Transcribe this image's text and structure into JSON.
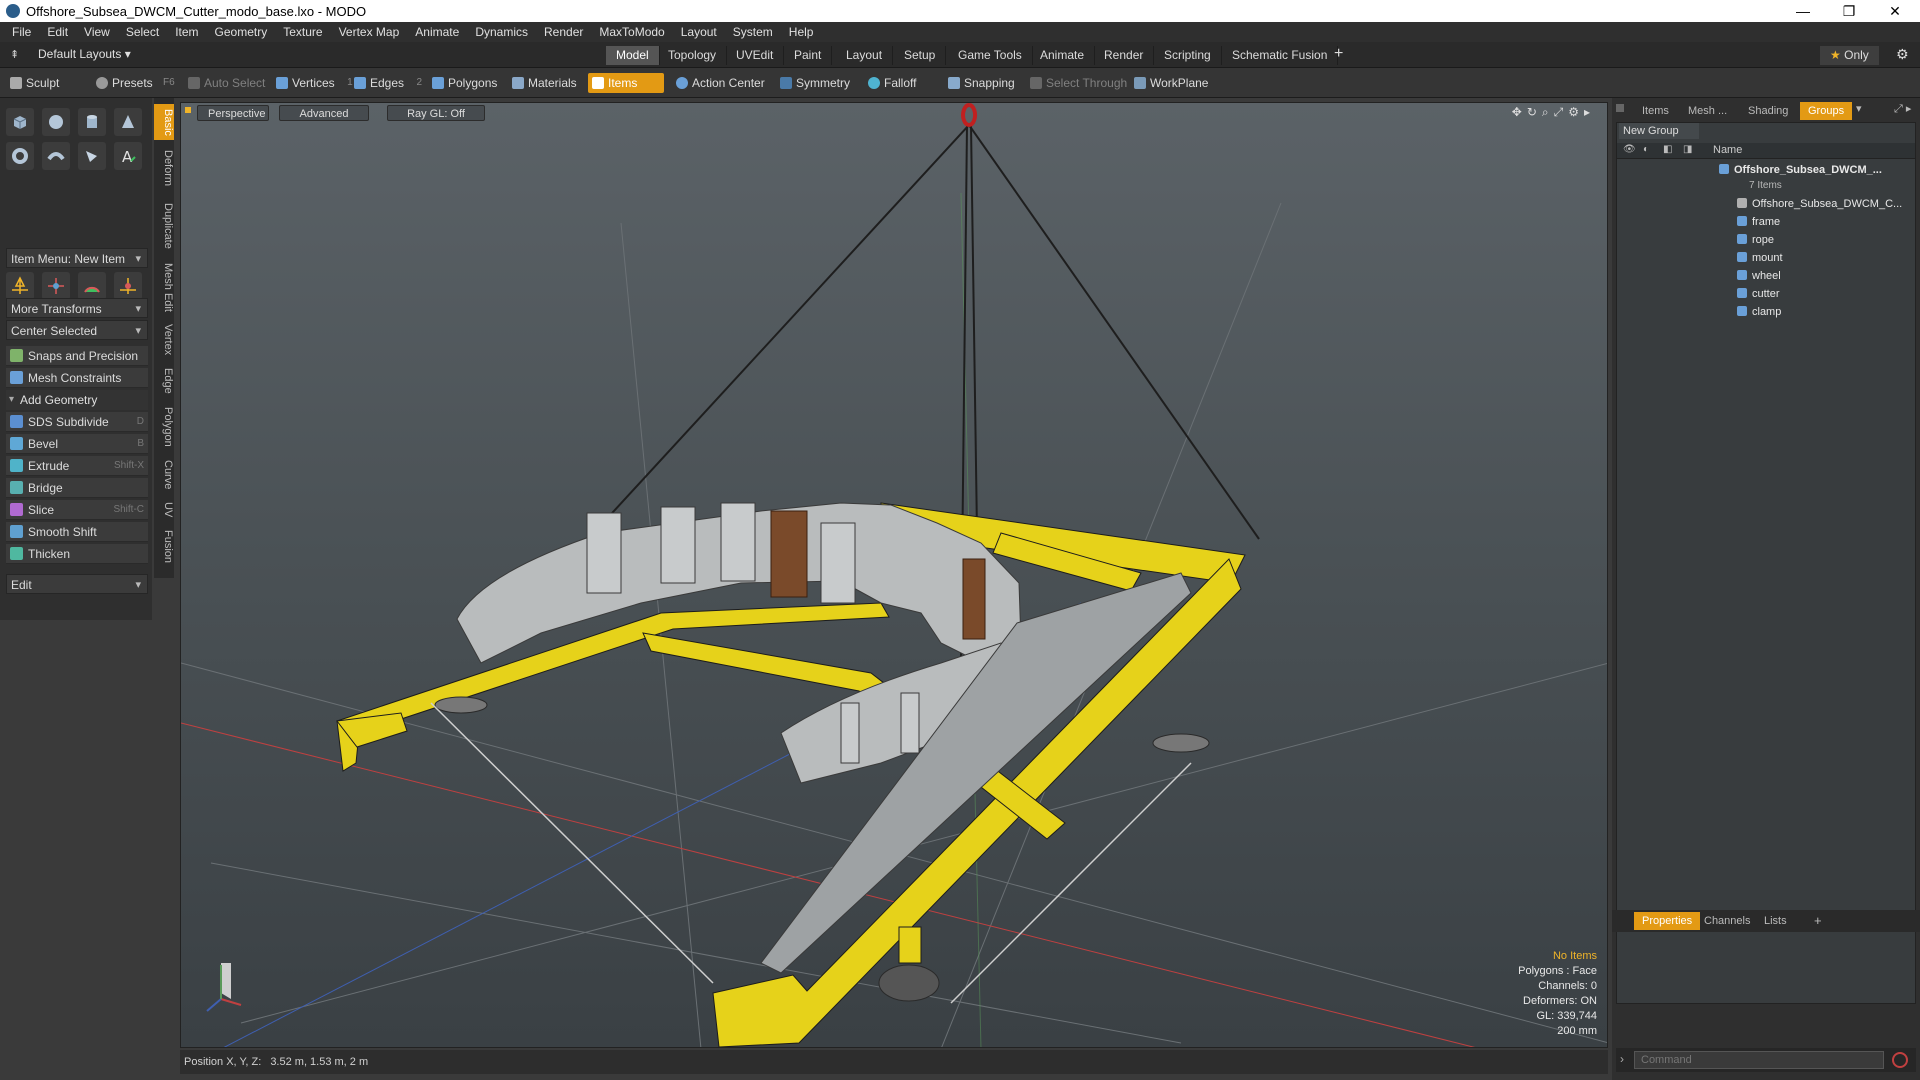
{
  "window": {
    "title": "Offshore_Subsea_DWCM_Cutter_modo_base.lxo - MODO",
    "minimize": "—",
    "maximize": "❐",
    "close": "✕"
  },
  "menu": [
    "File",
    "Edit",
    "View",
    "Select",
    "Item",
    "Geometry",
    "Texture",
    "Vertex Map",
    "Animate",
    "Dynamics",
    "Render",
    "MaxToModo",
    "Layout",
    "System",
    "Help"
  ],
  "layouts": {
    "default_label": "Default Layouts",
    "tabs": [
      "Model",
      "Topology",
      "UVEdit",
      "Paint",
      "Layout",
      "Setup",
      "Game Tools",
      "Animate",
      "Render",
      "Scripting",
      "Schematic Fusion"
    ],
    "active": "Model",
    "add": "+",
    "only_label": "Only"
  },
  "toolbar": {
    "sculpt": "Sculpt",
    "presets": "Presets",
    "presets_key": "F6",
    "auto_select": "Auto Select",
    "vertices": "Vertices",
    "vertices_key": "1",
    "edges": "Edges",
    "edges_key": "2",
    "polygons": "Polygons",
    "materials": "Materials",
    "items": "Items",
    "action_center": "Action Center",
    "symmetry": "Symmetry",
    "falloff": "Falloff",
    "snapping": "Snapping",
    "select_through": "Select Through",
    "workplane": "WorkPlane"
  },
  "left": {
    "item_menu": "Item Menu: New Item",
    "more_transforms": "More Transforms",
    "center_selected": "Center Selected",
    "snaps": "Snaps and Precision",
    "mesh_constraints": "Mesh Constraints",
    "add_geometry": "Add Geometry",
    "tools": [
      {
        "label": "SDS Subdivide",
        "key": "D",
        "color": "#5b8fd1"
      },
      {
        "label": "Bevel",
        "key": "B",
        "color": "#5fa8d6"
      },
      {
        "label": "Extrude",
        "key": "Shift-X",
        "color": "#4fb3c9"
      },
      {
        "label": "Bridge",
        "key": "",
        "color": "#58b0b0"
      },
      {
        "label": "Slice",
        "key": "Shift-C",
        "color": "#b06ad1"
      },
      {
        "label": "Smooth Shift",
        "key": "",
        "color": "#5fa0d0"
      },
      {
        "label": "Thicken",
        "key": "",
        "color": "#4fb8a0"
      }
    ],
    "edit": "Edit",
    "vtabs": [
      "Basic",
      "Deform",
      "Duplicate",
      "Mesh Edit",
      "Vertex",
      "Edge",
      "Polygon",
      "Curve",
      "UV",
      "Fusion"
    ]
  },
  "viewport": {
    "perspective": "Perspective",
    "advanced": "Advanced",
    "raygl": "Ray GL: Off",
    "info": {
      "no_items": "No Items",
      "polygons": "Polygons : Face",
      "channels": "Channels: 0",
      "deformers": "Deformers: ON",
      "gl": "GL: 339,744",
      "scale": "200 mm"
    }
  },
  "status": {
    "position_label": "Position X, Y, Z:",
    "position_value": "3.52 m, 1.53 m, 2 m"
  },
  "right": {
    "tabs": [
      "Items",
      "Mesh ...",
      "Shading",
      "Groups"
    ],
    "active_tab": "Groups",
    "new_group": "New Group",
    "name_col": "Name",
    "group_name": "Offshore_Subsea_DWCM_...",
    "group_count": "7 Items",
    "items": [
      "Offshore_Subsea_DWCM_C...",
      "frame",
      "rope",
      "mount",
      "wheel",
      "cutter",
      "clamp"
    ],
    "bottom_tabs": [
      "Properties",
      "Channels",
      "Lists"
    ],
    "bottom_active": "Properties",
    "command_placeholder": "Command"
  }
}
